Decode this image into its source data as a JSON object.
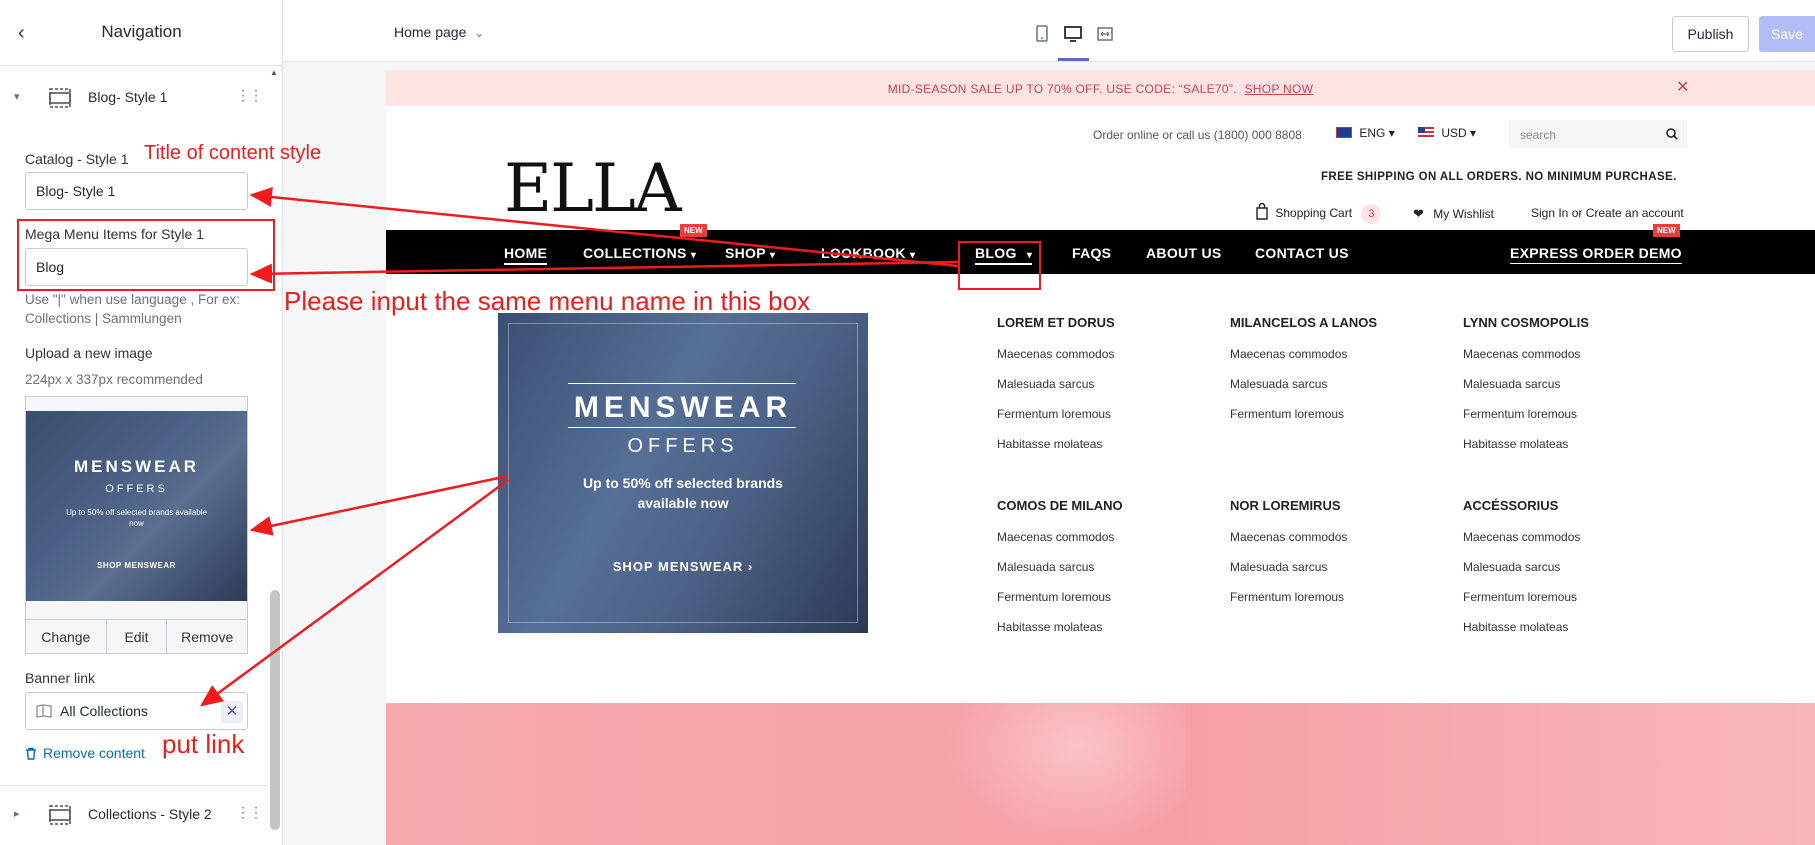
{
  "sidebar": {
    "title": "Navigation",
    "block_top": "Blog- Style 1",
    "content_title_label": "Catalog - Style 1",
    "content_title_value": "Blog- Style 1",
    "mega_label": "Mega Menu Items for Style 1",
    "mega_value": "Blog",
    "mega_help": "Use \"|\" when use language , For ex: Collections | Sammlungen",
    "upload_label": "Upload a new image",
    "upload_hint": "224px x 337px recommended",
    "thumb": {
      "title": "MENSWEAR",
      "subtitle": "OFFERS",
      "desc": "Up to 50% off selected brands available now",
      "cta": "SHOP MENSWEAR"
    },
    "image_actions": [
      "Change",
      "Edit",
      "Remove"
    ],
    "banner_link_label": "Banner link",
    "banner_link_value": "All Collections",
    "remove_content": "Remove content",
    "block_bottom": "Collections - Style 2"
  },
  "topbar": {
    "page_select": "Home page",
    "publish": "Publish",
    "save": "Save"
  },
  "store": {
    "announcement": "MID-SEASON SALE UP TO 70% OFF. USE CODE: “SALE70”.",
    "announcement_link": "SHOP NOW",
    "contact": "Order online or call us (1800) 000 8808",
    "lang": "ENG",
    "currency": "USD",
    "search_placeholder": "search",
    "logo": "ELLA",
    "shipping": "FREE SHIPPING ON ALL ORDERS. NO MINIMUM PURCHASE.",
    "cart_label": "Shopping Cart",
    "cart_count": "3",
    "wishlist": "My Wishlist",
    "account": "Sign In or Create an account",
    "nav": [
      "HOME",
      "COLLECTIONS",
      "SHOP",
      "LOOKBOOK",
      "BLOG",
      "FAQS",
      "ABOUT US",
      "CONTACT US",
      "EXPRESS ORDER DEMO"
    ],
    "new_badge": "NEW",
    "banner": {
      "title": "MENSWEAR",
      "subtitle": "OFFERS",
      "desc1": "Up to 50% off selected brands",
      "desc2": "available now",
      "cta": "SHOP MENSWEAR"
    },
    "columns": [
      {
        "head": "LOREM ET DORUS",
        "items": [
          "Maecenas commodos",
          "Malesuada sarcus",
          "Fermentum loremous",
          "Habitasse molateas"
        ]
      },
      {
        "head": "MILANCELOS A LANOS",
        "items": [
          "Maecenas commodos",
          "Malesuada sarcus",
          "Fermentum loremous"
        ]
      },
      {
        "head": "LYNN COSMOPOLIS",
        "items": [
          "Maecenas commodos",
          "Malesuada sarcus",
          "Fermentum loremous",
          "Habitasse molateas"
        ]
      },
      {
        "head": "COMOS DE MILANO",
        "items": [
          "Maecenas commodos",
          "Malesuada sarcus",
          "Fermentum loremous",
          "Habitasse molateas"
        ]
      },
      {
        "head": "NOR LOREMIRUS",
        "items": [
          "Maecenas commodos",
          "Malesuada sarcus",
          "Fermentum loremous"
        ]
      },
      {
        "head": "ACCÉSSORIUS",
        "items": [
          "Maecenas commodos",
          "Malesuada sarcus",
          "Fermentum loremous",
          "Habitasse molateas"
        ]
      }
    ]
  },
  "annotations": {
    "title_note": "Title of content style",
    "menu_note": "Please input the same menu name in this box",
    "link_note": "put link"
  },
  "colors": {
    "accent": "#ee1c1c",
    "nav_bg": "#000000",
    "promo_bg": "#fde3e3",
    "save_bg": "#b3bcf5",
    "link_blue": "#006fbb"
  }
}
